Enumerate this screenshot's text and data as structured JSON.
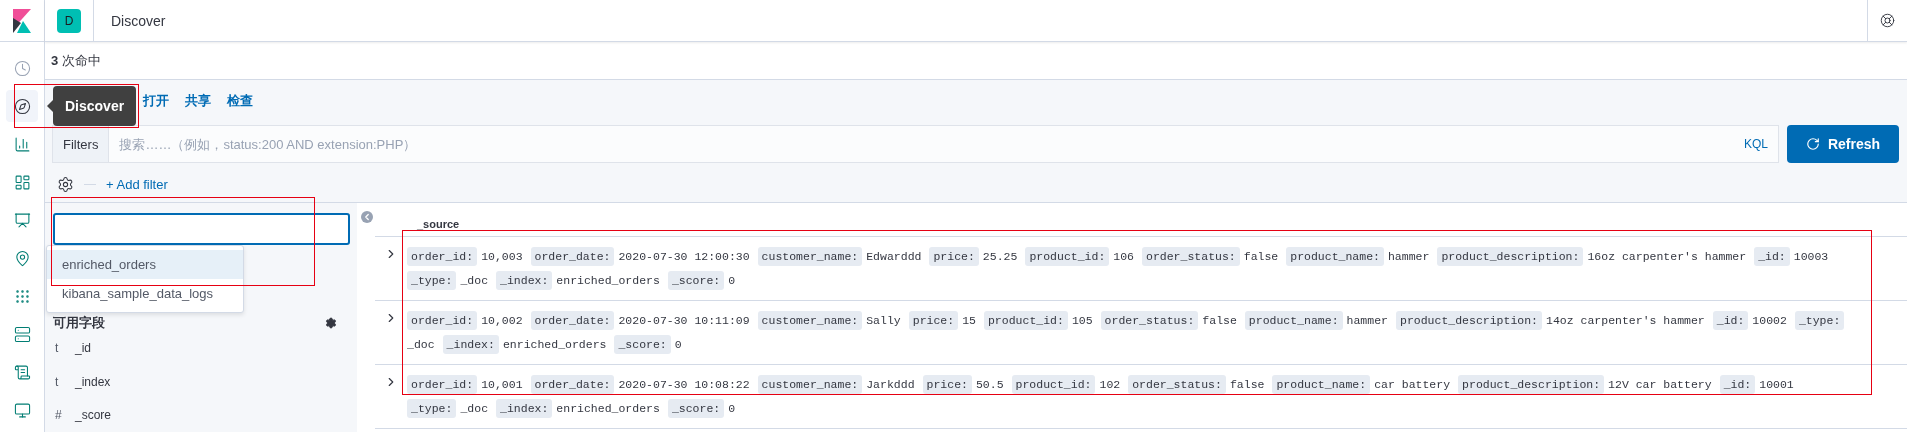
{
  "header": {
    "space_initial": "D",
    "title": "Discover"
  },
  "nav": {
    "items": [
      {
        "kind": "clock",
        "selected": false
      },
      {
        "kind": "compass",
        "selected": true
      },
      {
        "kind": "chart",
        "selected": false
      },
      {
        "kind": "dashboard",
        "selected": false
      },
      {
        "kind": "canvas",
        "selected": false
      },
      {
        "kind": "map",
        "selected": false
      },
      {
        "kind": "ml",
        "selected": false
      },
      {
        "kind": "infra",
        "selected": false
      },
      {
        "kind": "logs",
        "selected": false
      },
      {
        "kind": "apm",
        "selected": false
      }
    ]
  },
  "tooltip": "Discover",
  "hits": {
    "count": "3",
    "label": "次命中"
  },
  "top_menu": [
    "打开",
    "共享",
    "检查"
  ],
  "query": {
    "filters_label": "Filters",
    "placeholder": "搜索……（例如，status:200 AND extension:PHP）",
    "language": "KQL",
    "refresh_label": "Refresh"
  },
  "add_filter": "+ Add filter",
  "index_dropdown": {
    "options": [
      {
        "label": "enriched_orders",
        "selected": true
      },
      {
        "label": "kibana_sample_data_logs",
        "selected": false
      }
    ]
  },
  "fields": {
    "heading": "可用字段",
    "items": [
      {
        "type": "t",
        "name": "_id"
      },
      {
        "type": "t",
        "name": "_index"
      },
      {
        "type": "#",
        "name": "_score"
      }
    ]
  },
  "table": {
    "column": "_source",
    "rows": [
      {
        "fields": [
          {
            "key": "order_id:",
            "value": "10,003"
          },
          {
            "key": "order_date:",
            "value": "2020-07-30 12:00:30"
          },
          {
            "key": "customer_name:",
            "value": "Edwarddd"
          },
          {
            "key": "price:",
            "value": "25.25"
          },
          {
            "key": "product_id:",
            "value": "106"
          },
          {
            "key": "order_status:",
            "value": "false"
          },
          {
            "key": "product_name:",
            "value": "hammer"
          },
          {
            "key": "product_description:",
            "value": "16oz carpenter's hammer"
          },
          {
            "key": "_id:",
            "value": "10003"
          },
          {
            "key": "_type:",
            "value": "_doc"
          },
          {
            "key": "_index:",
            "value": "enriched_orders"
          },
          {
            "key": "_score:",
            "value": "0"
          }
        ]
      },
      {
        "fields": [
          {
            "key": "order_id:",
            "value": "10,002"
          },
          {
            "key": "order_date:",
            "value": "2020-07-30 10:11:09"
          },
          {
            "key": "customer_name:",
            "value": "Sally"
          },
          {
            "key": "price:",
            "value": "15"
          },
          {
            "key": "product_id:",
            "value": "105"
          },
          {
            "key": "order_status:",
            "value": "false"
          },
          {
            "key": "product_name:",
            "value": "hammer"
          },
          {
            "key": "product_description:",
            "value": "14oz carpenter's hammer"
          },
          {
            "key": "_id:",
            "value": "10002"
          },
          {
            "key": "_type:",
            "value": "_doc"
          },
          {
            "key": "_index:",
            "value": "enriched_orders"
          },
          {
            "key": "_score:",
            "value": "0"
          }
        ]
      },
      {
        "fields": [
          {
            "key": "order_id:",
            "value": "10,001"
          },
          {
            "key": "order_date:",
            "value": "2020-07-30 10:08:22"
          },
          {
            "key": "customer_name:",
            "value": "Jarkddd"
          },
          {
            "key": "price:",
            "value": "50.5"
          },
          {
            "key": "product_id:",
            "value": "102"
          },
          {
            "key": "order_status:",
            "value": "false"
          },
          {
            "key": "product_name:",
            "value": "car battery"
          },
          {
            "key": "product_description:",
            "value": "12V car battery"
          },
          {
            "key": "_id:",
            "value": "10001"
          },
          {
            "key": "_type:",
            "value": "_doc"
          },
          {
            "key": "_index:",
            "value": "enriched_orders"
          },
          {
            "key": "_score:",
            "value": "0"
          }
        ]
      }
    ]
  }
}
